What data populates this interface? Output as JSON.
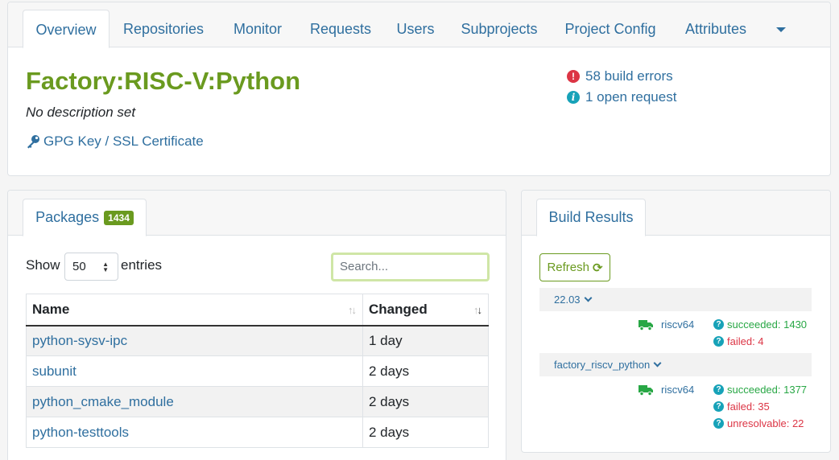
{
  "tabs": [
    {
      "label": "Overview",
      "active": true
    },
    {
      "label": "Repositories"
    },
    {
      "label": "Monitor"
    },
    {
      "label": "Requests"
    },
    {
      "label": "Users"
    },
    {
      "label": "Subprojects"
    },
    {
      "label": "Project Config"
    },
    {
      "label": "Attributes"
    }
  ],
  "project": {
    "title": "Factory:RISC-V:Python",
    "description": "No description set",
    "gpg_link": "GPG Key / SSL Certificate",
    "build_errors": "58 build errors",
    "open_requests": "1 open request"
  },
  "packages": {
    "tab_label": "Packages",
    "count": "1434",
    "show_label": "Show",
    "entries_label": "entries",
    "page_length": "50",
    "search_placeholder": "Search...",
    "columns": [
      "Name",
      "Changed"
    ],
    "rows": [
      {
        "name": "python-sysv-ipc",
        "changed": "1 day"
      },
      {
        "name": "subunit",
        "changed": "2 days"
      },
      {
        "name": "python_cmake_module",
        "changed": "2 days"
      },
      {
        "name": "python-testtools",
        "changed": "2 days"
      }
    ]
  },
  "build_results": {
    "tab_label": "Build Results",
    "refresh_label": "Refresh",
    "repositories": [
      {
        "name": "22.03",
        "arch": "riscv64",
        "results": [
          {
            "label": "succeeded: 1430",
            "status": "ok"
          },
          {
            "label": "failed: 4",
            "status": "bad"
          }
        ]
      },
      {
        "name": "factory_riscv_python",
        "arch": "riscv64",
        "results": [
          {
            "label": "succeeded: 1377",
            "status": "ok"
          },
          {
            "label": "failed: 35",
            "status": "bad"
          },
          {
            "label": "unresolvable: 22",
            "status": "bad"
          }
        ]
      }
    ]
  },
  "colors": {
    "accent": "#6a9a1f",
    "link": "#2f6f9f",
    "error": "#dc3545",
    "info": "#17a2b8"
  }
}
